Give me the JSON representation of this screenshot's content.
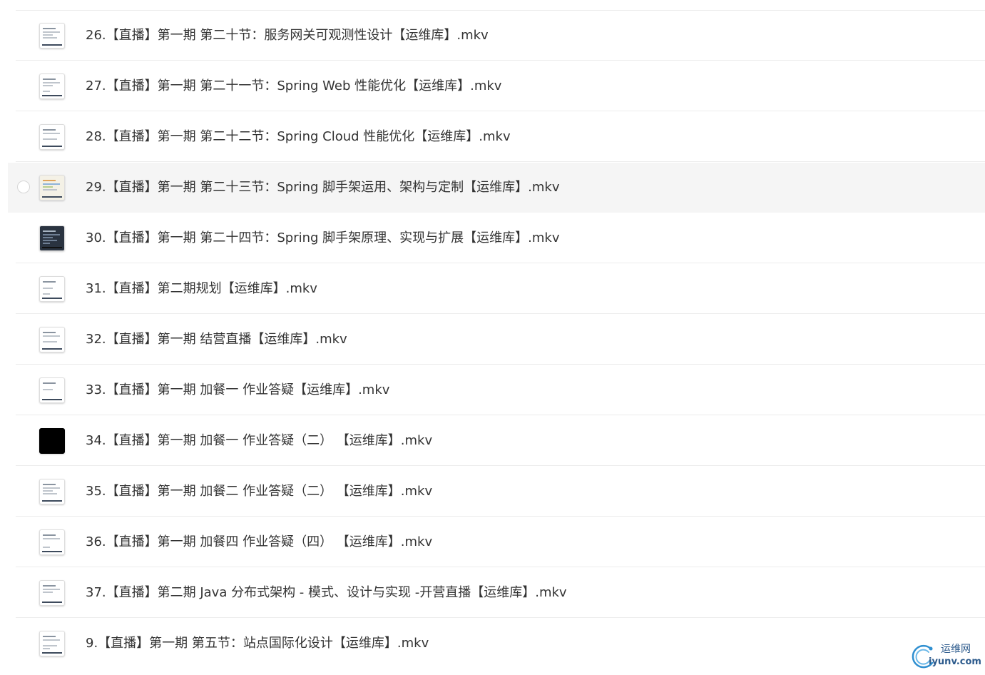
{
  "files": [
    {
      "name": "26.【直播】第一期 第二十节：服务网关可观测性设计【运维库】.mkv",
      "thumb": "document"
    },
    {
      "name": "27.【直播】第一期 第二十一节：Spring Web 性能优化【运维库】.mkv",
      "thumb": "document"
    },
    {
      "name": "28.【直播】第一期 第二十二节：Spring Cloud 性能优化【运维库】.mkv",
      "thumb": "document"
    },
    {
      "name": "29.【直播】第一期 第二十三节：Spring 脚手架运用、架构与定制【运维库】.mkv",
      "thumb": "colorful"
    },
    {
      "name": "30.【直播】第一期 第二十四节：Spring 脚手架原理、实现与扩展【运维库】.mkv",
      "thumb": "ide"
    },
    {
      "name": "31.【直播】第二期规划【运维库】.mkv",
      "thumb": "document"
    },
    {
      "name": "32.【直播】第一期 结营直播【运维库】.mkv",
      "thumb": "document"
    },
    {
      "name": "33.【直播】第一期 加餐一 作业答疑【运维库】.mkv",
      "thumb": "document"
    },
    {
      "name": "34.【直播】第一期 加餐一 作业答疑（二） 【运维库】.mkv",
      "thumb": "dark"
    },
    {
      "name": "35.【直播】第一期 加餐二 作业答疑（二） 【运维库】.mkv",
      "thumb": "document"
    },
    {
      "name": "36.【直播】第一期 加餐四 作业答疑（四） 【运维库】.mkv",
      "thumb": "document"
    },
    {
      "name": "37.【直播】第二期 Java 分布式架构 - 模式、设计与实现 -开营直播【运维库】.mkv",
      "thumb": "document"
    },
    {
      "name": "9.【直播】第一期 第五节：站点国际化设计【运维库】.mkv",
      "thumb": "document"
    }
  ],
  "hovered_index": 3,
  "watermark": {
    "cn_text": "运维网",
    "en_text": "iyunv.com",
    "color": "#2c5a8c"
  }
}
